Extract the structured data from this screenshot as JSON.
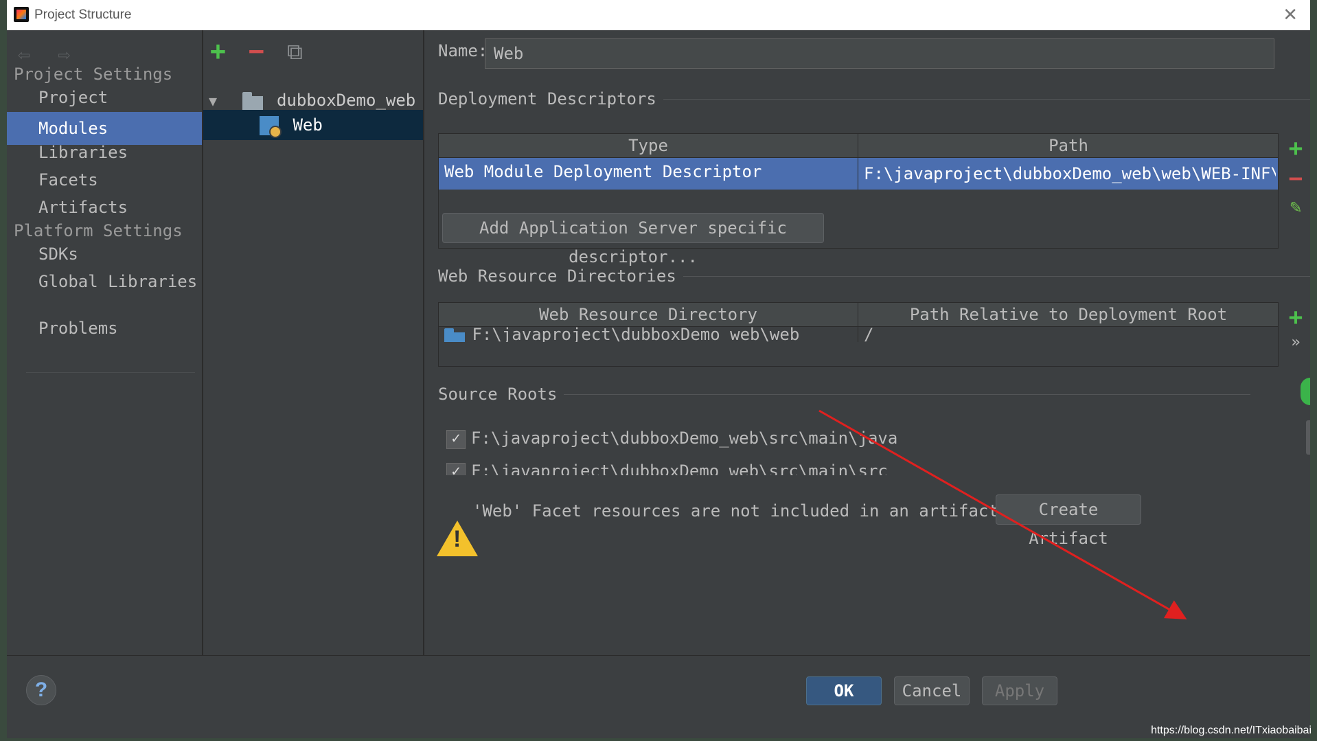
{
  "window": {
    "title": "Project Structure",
    "close": "✕"
  },
  "nav": {
    "back": "⇦",
    "forward": "⇨",
    "project_settings": "Project Settings",
    "platform_settings": "Platform Settings",
    "items": [
      "Project",
      "Modules",
      "Libraries",
      "Facets",
      "Artifacts"
    ],
    "platform_items": [
      "SDKs",
      "Global Libraries"
    ],
    "problems": "Problems",
    "selected": "Modules"
  },
  "tree": {
    "add": "+",
    "remove": "−",
    "copy": "⧉",
    "expander": "▼",
    "module": "dubboxDemo_web",
    "facet": "Web"
  },
  "facet": {
    "name_label": "Name:",
    "name_value": "Web",
    "deployment_descriptors": "Deployment Descriptors",
    "dd_columns": [
      "Type",
      "Path"
    ],
    "dd_rows": [
      {
        "type": "Web Module Deployment Descriptor",
        "path": "F:\\javaproject\\dubboxDemo_web\\web\\WEB-INF\\web.xml"
      }
    ],
    "add_server_descriptor": "Add Application Server specific descriptor...",
    "web_resource_directories": "Web Resource Directories",
    "wr_columns": [
      "Web Resource Directory",
      "Path Relative to Deployment Root"
    ],
    "wr_rows": [
      {
        "dir": "F:\\javaproject\\dubboxDemo_web\\web",
        "rel": "/"
      }
    ],
    "more": "»",
    "source_roots": "Source Roots",
    "source_rows": [
      "F:\\javaproject\\dubboxDemo_web\\src\\main\\java",
      "F:\\javaproject\\dubboxDemo web\\src\\main\\src"
    ],
    "check": "✓",
    "warning": "'Web' Facet resources are not included in an artifact",
    "create_artifact": "Create Artifact"
  },
  "footer": {
    "help": "?",
    "ok": "OK",
    "cancel": "Cancel",
    "apply": "Apply"
  },
  "watermark": "https://blog.csdn.net/ITxiaobaibai",
  "colors": {
    "selection": "#4b6eaf",
    "background": "#3c3f41",
    "annotation_arrow": "#e0201f"
  }
}
